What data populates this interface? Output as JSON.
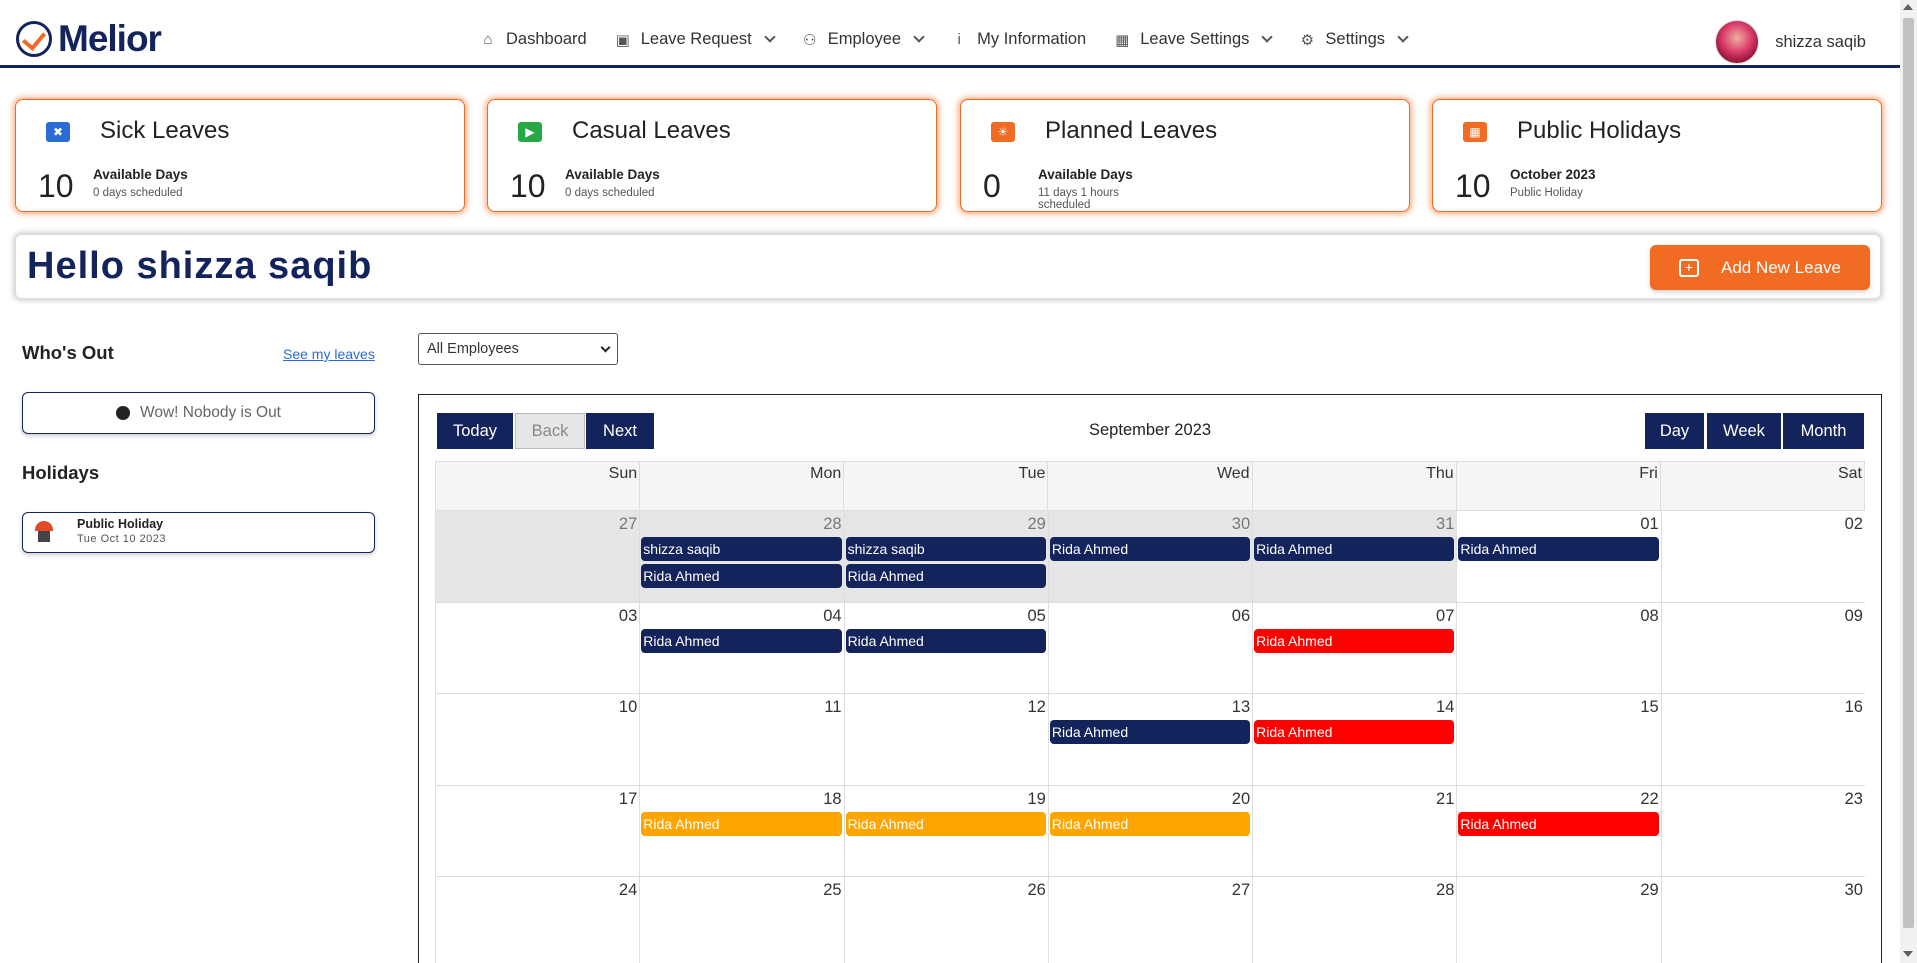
{
  "colors": {
    "navy": "#13235b",
    "orange": "#f26b22",
    "red": "#ff0000",
    "amber": "#ffa500"
  },
  "header": {
    "brand": "Melior",
    "nav": [
      {
        "label": "Dashboard",
        "icon": "home-icon",
        "dropdown": false
      },
      {
        "label": "Leave Request",
        "icon": "calendar-plus-icon",
        "dropdown": true
      },
      {
        "label": "Employee",
        "icon": "users-icon",
        "dropdown": true
      },
      {
        "label": "My Information",
        "icon": "info-icon",
        "dropdown": false
      },
      {
        "label": "Leave Settings",
        "icon": "calendar-icon",
        "dropdown": true
      },
      {
        "label": "Settings",
        "icon": "gear-icon",
        "dropdown": true
      }
    ],
    "user_name": "shizza saqib"
  },
  "cards": [
    {
      "title": "Sick Leaves",
      "number": "10",
      "label": "Available Days",
      "sub": "0 days scheduled",
      "icon": "bandage-icon",
      "icon_color": "#2a6bd6"
    },
    {
      "title": "Casual Leaves",
      "number": "10",
      "label": "Available Days",
      "sub": "0 days scheduled",
      "icon": "ticket-icon",
      "icon_color": "#28a745"
    },
    {
      "title": "Planned Leaves",
      "number": "0",
      "label": "Available Days",
      "sub": "11 days 1 hours scheduled",
      "icon": "beach-icon",
      "icon_color": "#f26b22"
    },
    {
      "title": "Public Holidays",
      "number": "10",
      "label": "October 2023",
      "sub": "Public Holiday",
      "icon": "calendar-icon",
      "icon_color": "#f26b22"
    }
  ],
  "greeting": "Hello shizza saqib",
  "add_leave_label": "Add New Leave",
  "whos_out": {
    "title": "Who's Out",
    "link": "See my leaves",
    "empty": "Wow! Nobody is Out"
  },
  "holidays": {
    "title": "Holidays",
    "items": [
      {
        "name": "Public Holiday",
        "date": "Tue Oct 10 2023"
      }
    ]
  },
  "employee_filter": "All Employees",
  "calendar": {
    "title": "September 2023",
    "buttons": {
      "today": "Today",
      "back": "Back",
      "next": "Next",
      "day": "Day",
      "week": "Week",
      "month": "Month"
    },
    "weekdays": [
      "Sun",
      "Mon",
      "Tue",
      "Wed",
      "Thu",
      "Fri",
      "Sat"
    ],
    "weeks": [
      [
        "27",
        "28",
        "29",
        "30",
        "31",
        "01",
        "02"
      ],
      [
        "03",
        "04",
        "05",
        "06",
        "07",
        "08",
        "09"
      ],
      [
        "10",
        "11",
        "12",
        "13",
        "14",
        "15",
        "16"
      ],
      [
        "17",
        "18",
        "19",
        "20",
        "21",
        "22",
        "23"
      ],
      [
        "24",
        "25",
        "26",
        "27",
        "28",
        "29",
        "30"
      ]
    ],
    "off_range": [
      [
        0,
        0
      ],
      [
        0,
        1
      ],
      [
        0,
        2
      ],
      [
        0,
        3
      ],
      [
        0,
        4
      ]
    ],
    "events": [
      {
        "week": 0,
        "day": 1,
        "row": 0,
        "name": "shizza saqib",
        "color": "navy"
      },
      {
        "week": 0,
        "day": 2,
        "row": 0,
        "name": "shizza saqib",
        "color": "navy"
      },
      {
        "week": 0,
        "day": 1,
        "row": 1,
        "name": "Rida Ahmed",
        "color": "navy"
      },
      {
        "week": 0,
        "day": 2,
        "row": 1,
        "name": "Rida Ahmed",
        "color": "navy"
      },
      {
        "week": 0,
        "day": 3,
        "row": 0,
        "name": "Rida Ahmed",
        "color": "navy"
      },
      {
        "week": 0,
        "day": 4,
        "row": 0,
        "name": "Rida Ahmed",
        "color": "navy"
      },
      {
        "week": 0,
        "day": 5,
        "row": 0,
        "name": "Rida Ahmed",
        "color": "navy"
      },
      {
        "week": 1,
        "day": 1,
        "row": 0,
        "name": "Rida Ahmed",
        "color": "navy"
      },
      {
        "week": 1,
        "day": 2,
        "row": 0,
        "name": "Rida Ahmed",
        "color": "navy"
      },
      {
        "week": 1,
        "day": 4,
        "row": 0,
        "name": "Rida Ahmed",
        "color": "red"
      },
      {
        "week": 2,
        "day": 3,
        "row": 0,
        "name": "Rida Ahmed",
        "color": "navy"
      },
      {
        "week": 2,
        "day": 4,
        "row": 0,
        "name": "Rida Ahmed",
        "color": "red"
      },
      {
        "week": 3,
        "day": 1,
        "row": 0,
        "name": "Rida Ahmed",
        "color": "amber"
      },
      {
        "week": 3,
        "day": 2,
        "row": 0,
        "name": "Rida Ahmed",
        "color": "amber"
      },
      {
        "week": 3,
        "day": 3,
        "row": 0,
        "name": "Rida Ahmed",
        "color": "amber"
      },
      {
        "week": 3,
        "day": 5,
        "row": 0,
        "name": "Rida Ahmed",
        "color": "red"
      }
    ]
  }
}
